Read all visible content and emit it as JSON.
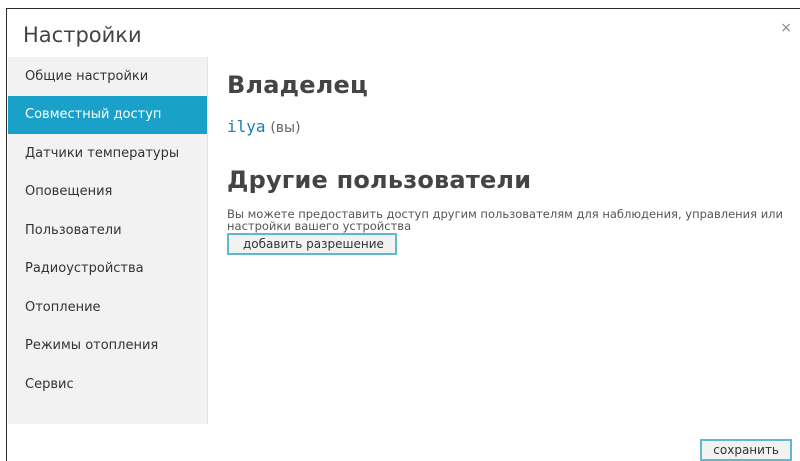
{
  "dialog": {
    "title": "Настройки",
    "close_label": "×",
    "save_label": "сохранить"
  },
  "sidebar": {
    "active_index": 1,
    "items": [
      {
        "label": "Общие настройки"
      },
      {
        "label": "Совместный доступ"
      },
      {
        "label": "Датчики температуры"
      },
      {
        "label": "Оповещения"
      },
      {
        "label": "Пользователи"
      },
      {
        "label": "Радиоустройства"
      },
      {
        "label": "Отопление"
      },
      {
        "label": "Режимы отопления"
      },
      {
        "label": "Сервис"
      }
    ]
  },
  "main": {
    "owner_title": "Владелец",
    "owner_name": "ilya",
    "owner_suffix": "(вы)",
    "others_title": "Другие пользователи",
    "others_description": "Вы можете предоставить доступ другим пользователям для наблюдения, управления или настройки вашего устройства",
    "add_permission_label": "добавить разрешение"
  },
  "colors": {
    "accent": "#1aa1c9",
    "button_border": "#5fb8cc",
    "owner_link": "#1a7fb0"
  }
}
